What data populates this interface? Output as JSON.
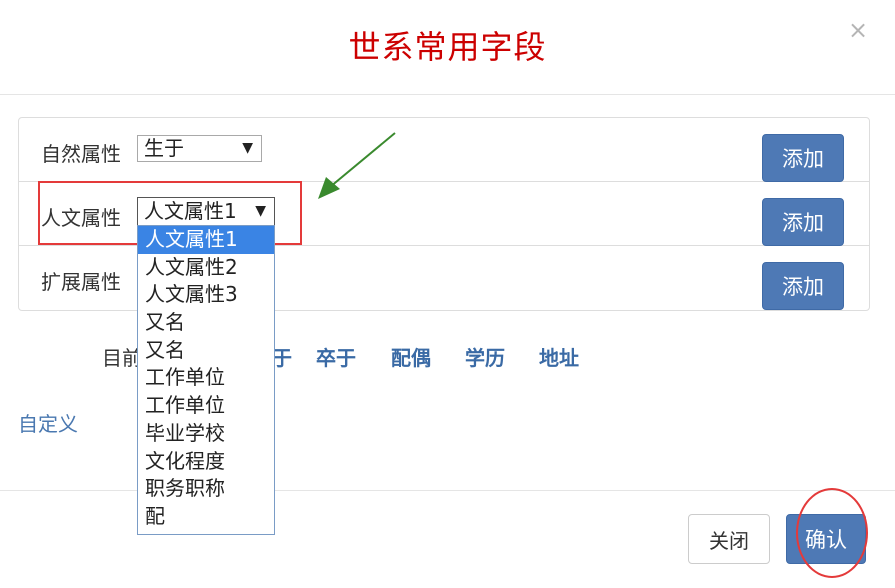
{
  "modal": {
    "title": "世系常用字段",
    "close_glyph": "×"
  },
  "rows": [
    {
      "label": "自然属性",
      "select_value": "生于",
      "add_label": "添加"
    },
    {
      "label": "人文属性",
      "select_value": "人文属性1",
      "add_label": "添加"
    },
    {
      "label": "扩展属性",
      "add_label": "添加"
    }
  ],
  "dropdown": {
    "options": [
      "人文属性1",
      "人文属性2",
      "人文属性3",
      "又名",
      "又名",
      "工作单位",
      "工作单位",
      "毕业学校",
      "文化程度",
      "职务职称",
      "配"
    ],
    "selected_index": 0
  },
  "current": {
    "label": "目前",
    "fields": [
      "于",
      "卒于",
      "配偶",
      "学历",
      "地址"
    ]
  },
  "custom_link": "自定义",
  "footer": {
    "close_label": "关闭",
    "confirm_label": "确认"
  },
  "colors": {
    "title": "#cc0000",
    "primary_button": "#4e79b5",
    "annotation_red": "#e43a3a",
    "annotation_arrow": "#3a8a2e",
    "link": "#3a6aa5"
  },
  "icons": {
    "caret": "triangle-down-icon",
    "close": "close-icon"
  }
}
